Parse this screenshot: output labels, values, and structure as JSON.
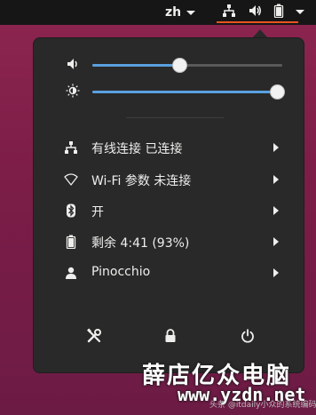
{
  "topbar": {
    "language": "zh",
    "icons": [
      "network-wired-question-icon",
      "volume-icon",
      "battery-icon",
      "chevron-down-icon"
    ]
  },
  "sliders": {
    "volume": {
      "icon": "volume-icon",
      "level": 0.46
    },
    "brightness": {
      "icon": "brightness-icon",
      "level": 0.97
    }
  },
  "menu": {
    "items": [
      {
        "icon": "network-wired-question-icon",
        "label": "有线连接 已连接"
      },
      {
        "icon": "wifi-icon",
        "label": "Wi-Fi 参数 未连接"
      },
      {
        "icon": "bluetooth-icon",
        "label": "开"
      },
      {
        "icon": "battery-icon",
        "label": "剩余 4:41 (93%)"
      },
      {
        "icon": "user-icon",
        "label": "Pinocchio"
      }
    ]
  },
  "actions": [
    {
      "icon": "settings-tools-icon"
    },
    {
      "icon": "lock-icon"
    },
    {
      "icon": "power-icon"
    }
  ],
  "watermark": {
    "small": "头条 @itdaily小众的系统编码",
    "big": "薛店亿众电脑",
    "url": "www.yzdn.net"
  },
  "colors": {
    "accent": "#e95420",
    "slider_fill": "#5aa0e0",
    "panel_bg": "#292929",
    "topbar_bg": "#161616"
  }
}
